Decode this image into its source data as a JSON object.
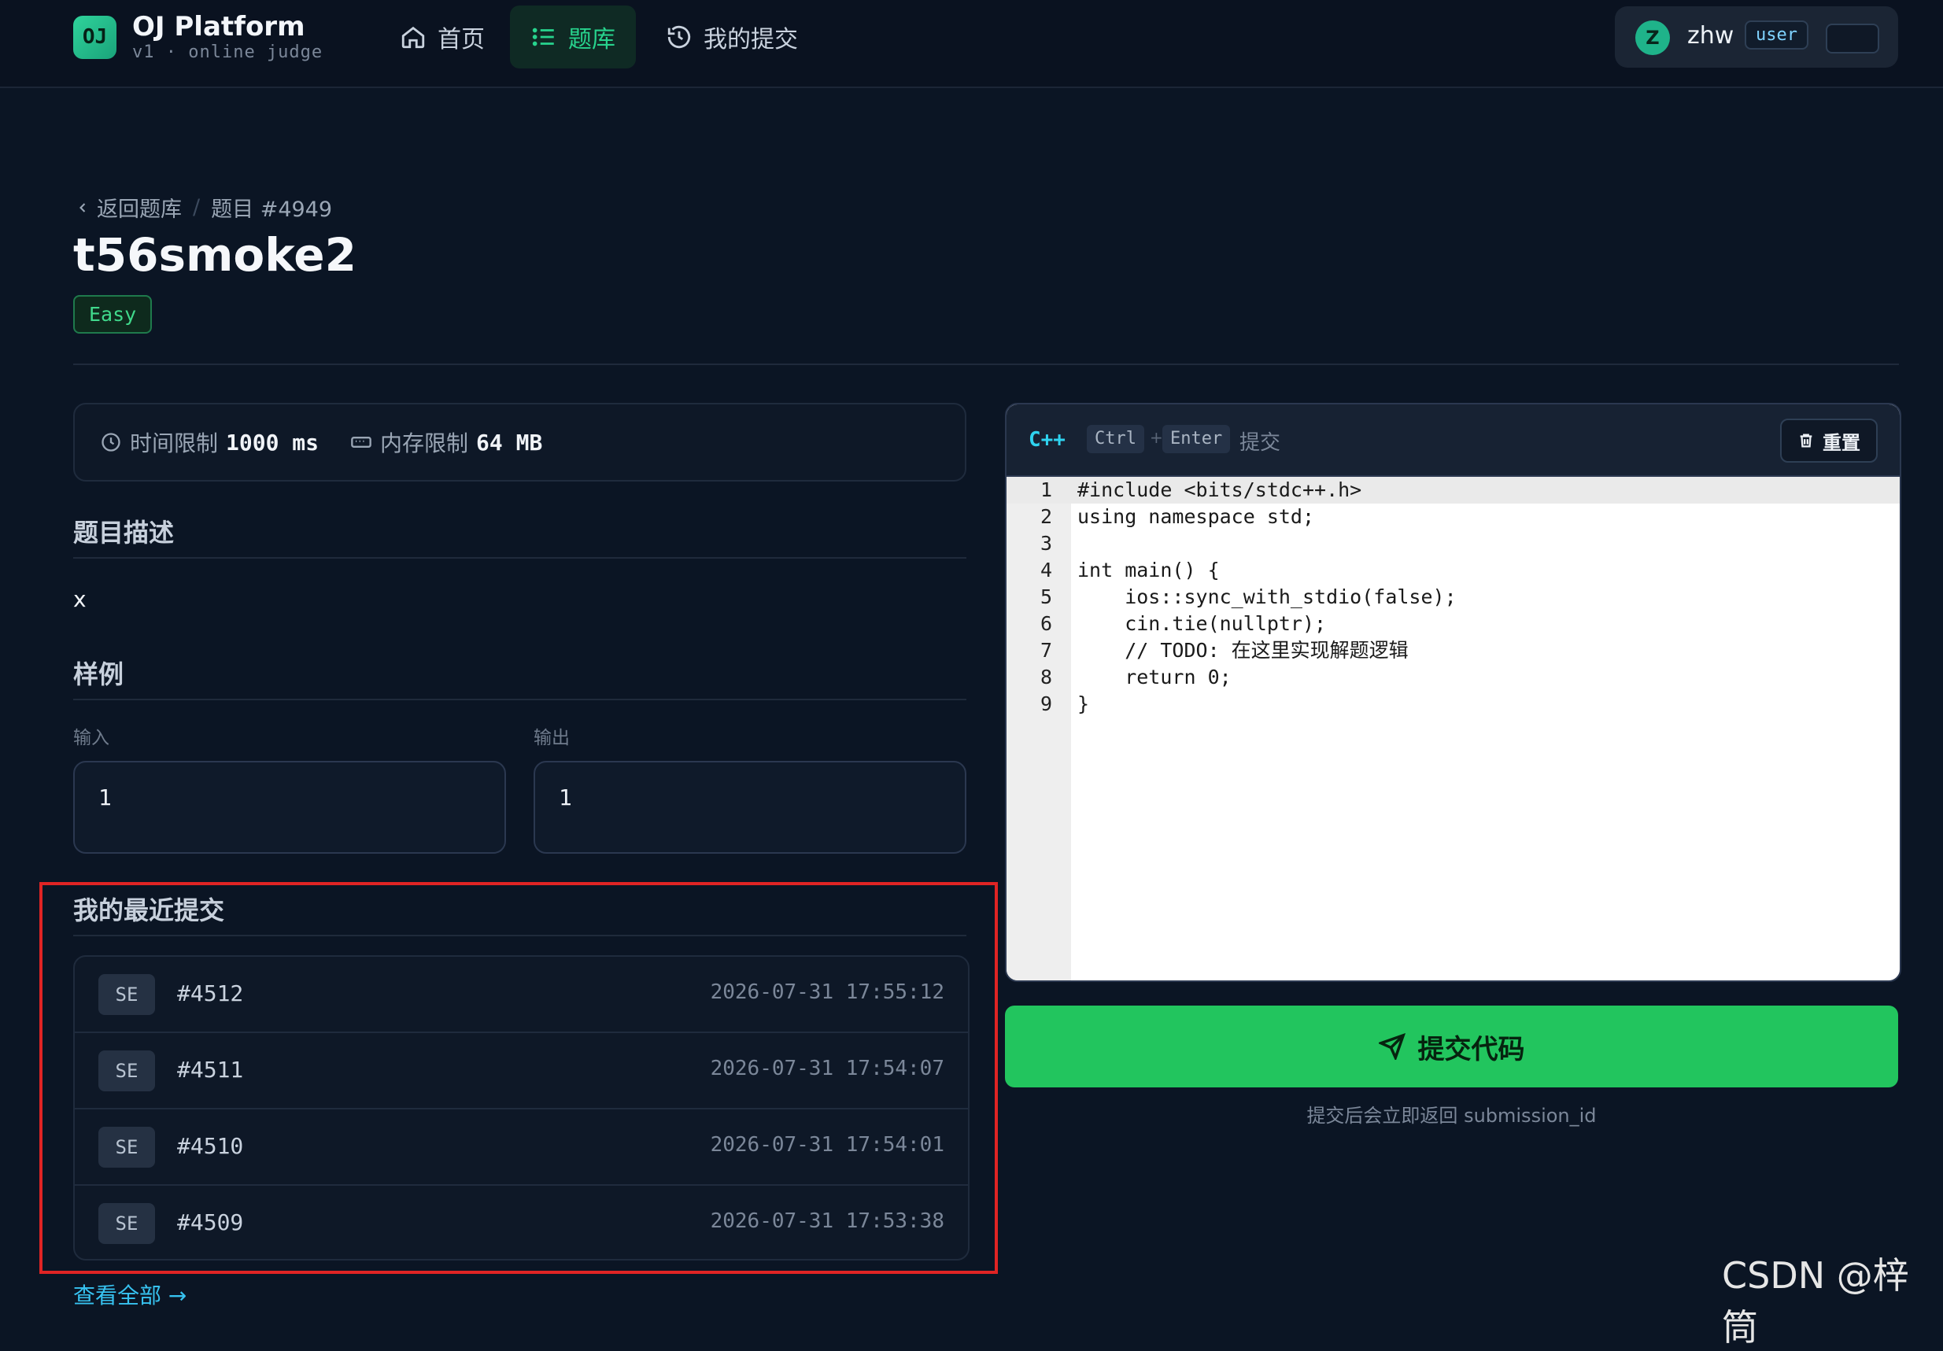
{
  "brand": {
    "logo": "OJ",
    "name": "OJ Platform",
    "subtitle": "v1 · online judge"
  },
  "nav": [
    {
      "label": "首页",
      "icon": "home-icon"
    },
    {
      "label": "题库",
      "icon": "list-icon",
      "active": true
    },
    {
      "label": "我的提交",
      "icon": "history-icon"
    }
  ],
  "user": {
    "avatar": "Z",
    "name": "zhw",
    "role": "user"
  },
  "breadcrumb": {
    "back": "返回题库",
    "current": "题目 #4949"
  },
  "problem": {
    "title": "t56smoke2",
    "difficulty": "Easy",
    "time_label": "时间限制",
    "time_value": "1000 ms",
    "memory_label": "内存限制",
    "memory_value": "64 MB",
    "desc_title": "题目描述",
    "desc_text": "x",
    "sample_title": "样例",
    "input_label": "输入",
    "output_label": "输出",
    "sample_input": "1",
    "sample_output": "1"
  },
  "recent": {
    "title": "我的最近提交",
    "items": [
      {
        "status": "SE",
        "id": "#4512",
        "time": "2026-07-31 17:55:12"
      },
      {
        "status": "SE",
        "id": "#4511",
        "time": "2026-07-31 17:54:07"
      },
      {
        "status": "SE",
        "id": "#4510",
        "time": "2026-07-31 17:54:01"
      },
      {
        "status": "SE",
        "id": "#4509",
        "time": "2026-07-31 17:53:38"
      }
    ],
    "view_all": "查看全部 →"
  },
  "editor": {
    "language": "C++",
    "key1": "Ctrl",
    "key_plus": "+",
    "key2": "Enter",
    "hint": "提交",
    "reset_label": "重置",
    "lines": [
      {
        "n": "1",
        "code": "#include <bits/stdc++.h>"
      },
      {
        "n": "2",
        "code": "using namespace std;"
      },
      {
        "n": "3",
        "code": ""
      },
      {
        "n": "4",
        "code": "int main() {"
      },
      {
        "n": "5",
        "code": "    ios::sync_with_stdio(false);"
      },
      {
        "n": "6",
        "code": "    cin.tie(nullptr);"
      },
      {
        "n": "7",
        "code": "    // TODO: 在这里实现解题逻辑"
      },
      {
        "n": "8",
        "code": "    return 0;"
      },
      {
        "n": "9",
        "code": "}"
      }
    ]
  },
  "submit": {
    "label": "提交代码",
    "hint": "提交后会立即返回 submission_id"
  },
  "watermark": "CSDN @梓筒",
  "colors": {
    "accent": "#22c55e",
    "link": "#37c2f0",
    "highlight": "#e02424"
  }
}
